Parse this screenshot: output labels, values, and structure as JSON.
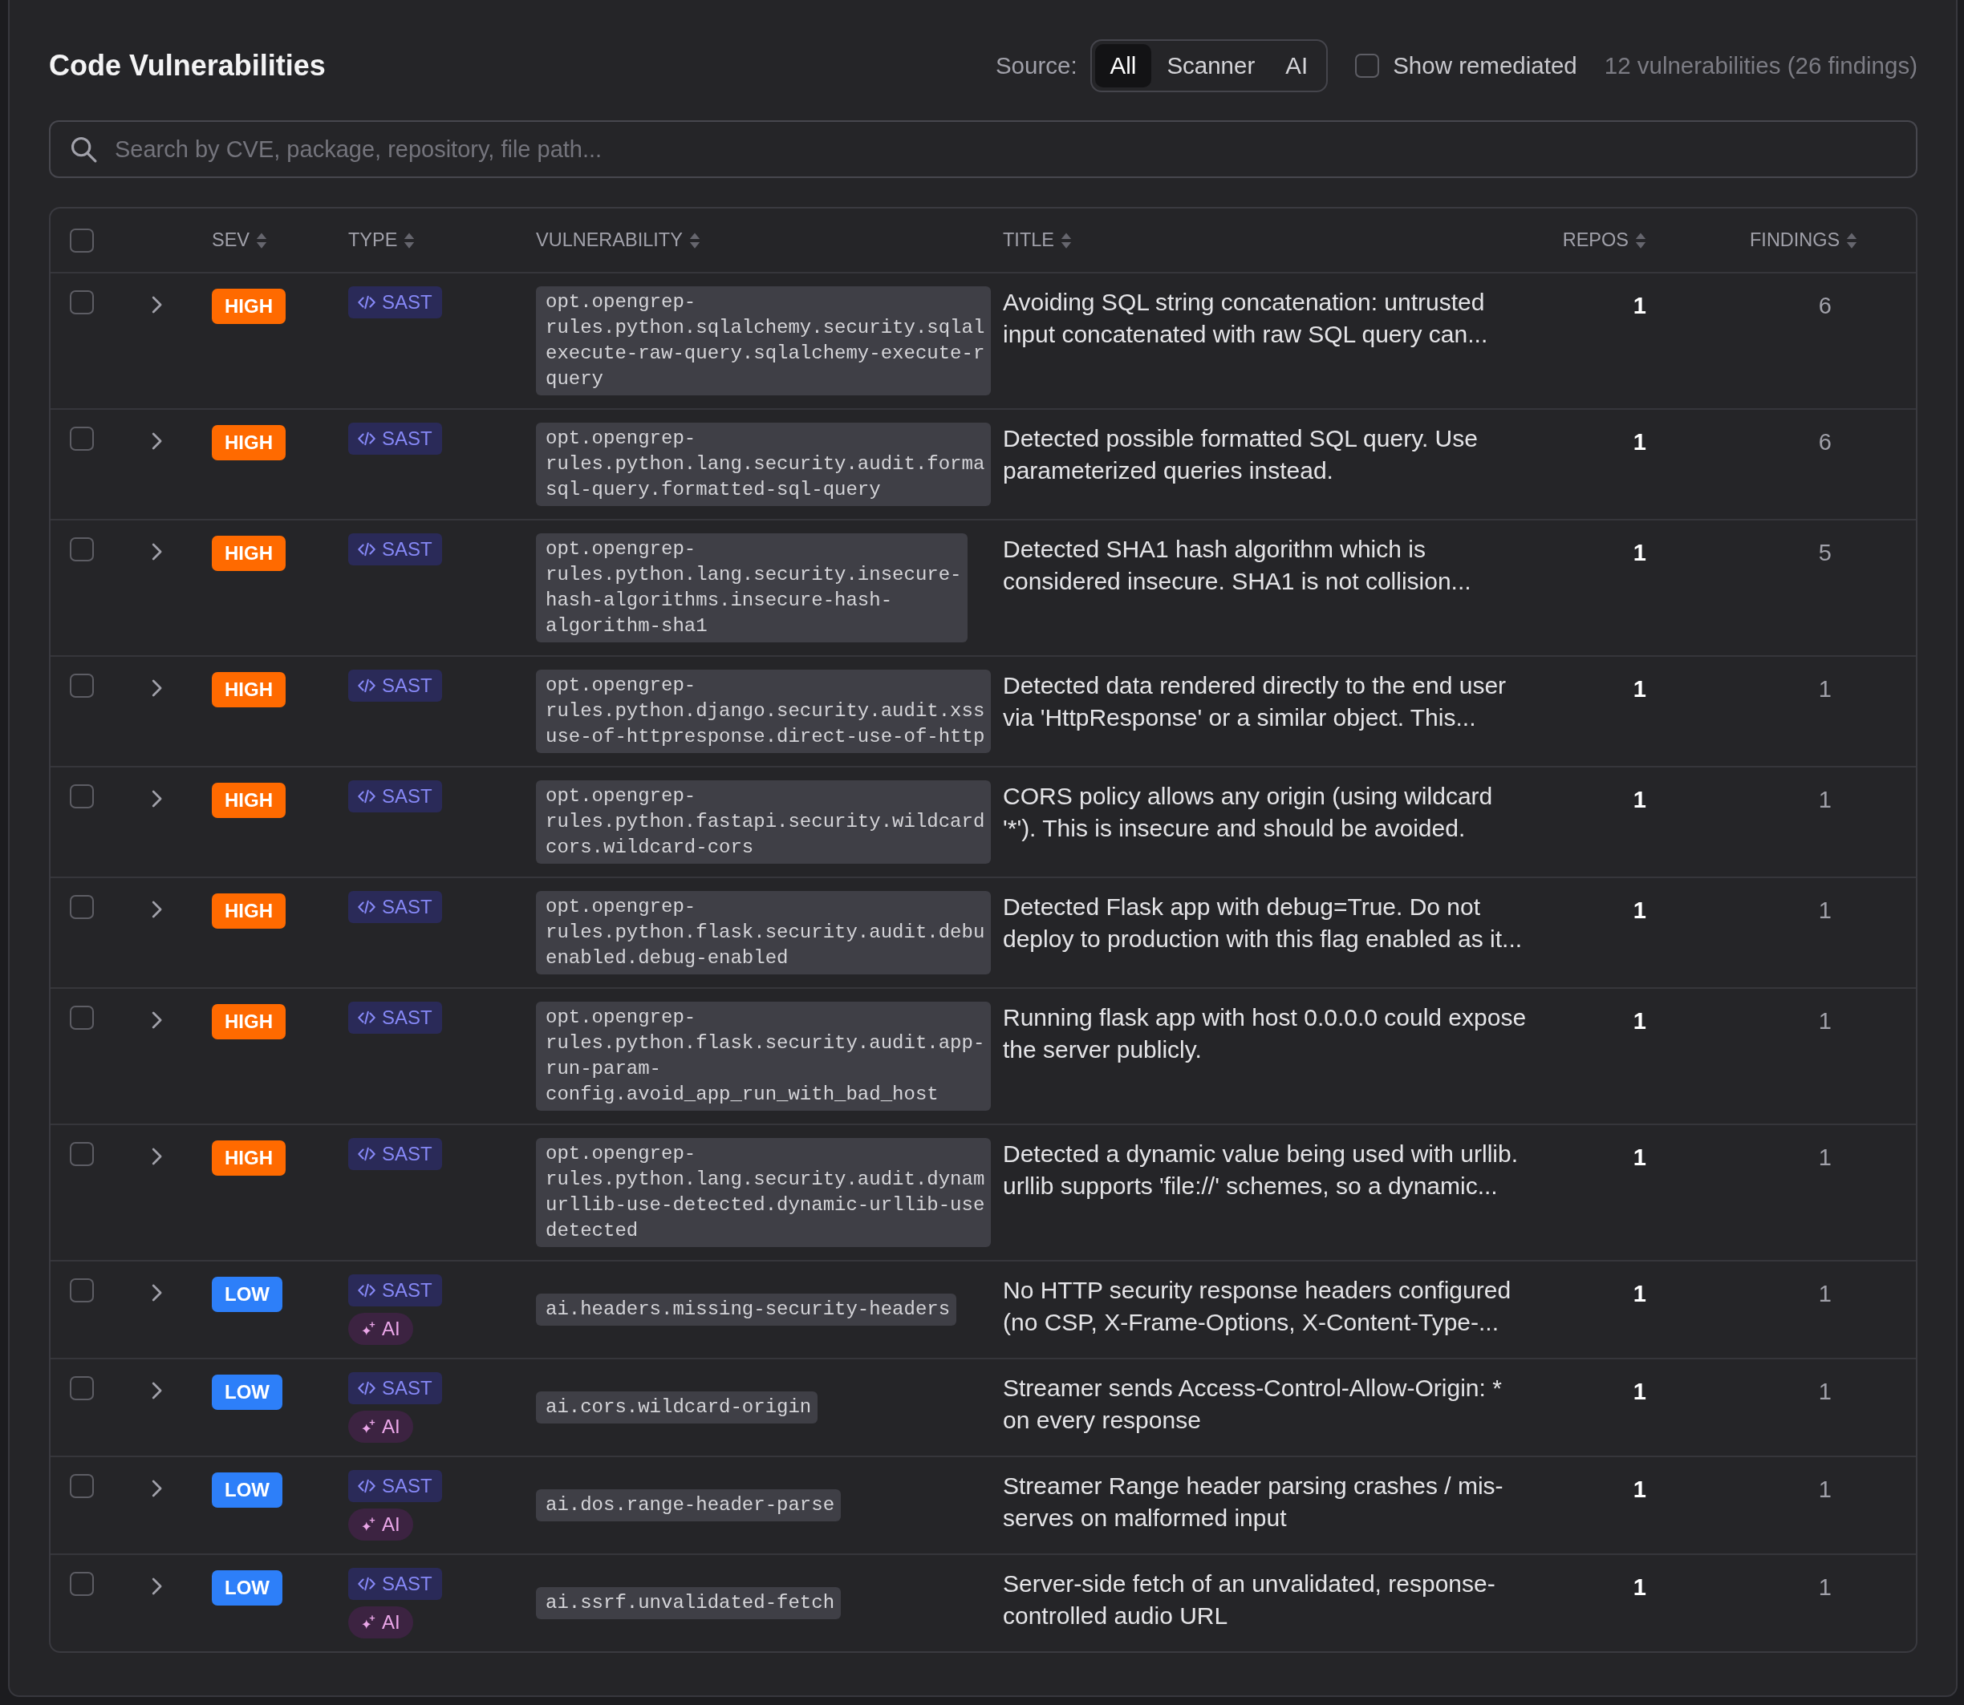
{
  "header": {
    "title": "Code Vulnerabilities",
    "source_filter": {
      "label": "Source:",
      "options": [
        {
          "label": "All",
          "selected": true
        },
        {
          "label": "Scanner",
          "selected": false
        },
        {
          "label": "AI",
          "selected": false
        }
      ]
    },
    "show_remediated": {
      "label": "Show remediated",
      "checked": false
    },
    "summary": "12 vulnerabilities (26 findings)"
  },
  "search": {
    "placeholder": "Search by CVE, package, repository, file path..."
  },
  "table": {
    "select_all": {
      "checked": false
    },
    "columns": [
      {
        "label": "SEV",
        "sortable": true
      },
      {
        "label": "TYPE",
        "sortable": true
      },
      {
        "label": "VULNERABILITY",
        "sortable": true
      },
      {
        "label": "TITLE",
        "sortable": true
      },
      {
        "label": "REPOS",
        "sortable": true
      },
      {
        "label": "FINDINGS",
        "sortable": true
      }
    ],
    "rows": [
      {
        "selected": false,
        "expanded": false,
        "severity": {
          "label": "HIGH",
          "color": "#ff6a00"
        },
        "types": [
          {
            "kind": "sast",
            "label": "SAST"
          }
        ],
        "vulnerability": "opt.opengrep-\nrules.python.sqlalchemy.security.sqlal\nexecute-raw-query.sqlalchemy-execute-r\nquery",
        "title": "Avoiding SQL string concatenation: untrusted input concatenated with raw SQL query can...",
        "repos": "1",
        "findings": "6"
      },
      {
        "selected": false,
        "expanded": false,
        "severity": {
          "label": "HIGH",
          "color": "#ff6a00"
        },
        "types": [
          {
            "kind": "sast",
            "label": "SAST"
          }
        ],
        "vulnerability": "opt.opengrep-\nrules.python.lang.security.audit.forma\nsql-query.formatted-sql-query",
        "title": "Detected possible formatted SQL query. Use parameterized queries instead.",
        "repos": "1",
        "findings": "6"
      },
      {
        "selected": false,
        "expanded": false,
        "severity": {
          "label": "HIGH",
          "color": "#ff6a00"
        },
        "types": [
          {
            "kind": "sast",
            "label": "SAST"
          }
        ],
        "vulnerability": "opt.opengrep-\nrules.python.lang.security.insecure-\nhash-algorithms.insecure-hash-\nalgorithm-sha1",
        "title": "Detected SHA1 hash algorithm which is considered insecure. SHA1 is not collision...",
        "repos": "1",
        "findings": "5"
      },
      {
        "selected": false,
        "expanded": false,
        "severity": {
          "label": "HIGH",
          "color": "#ff6a00"
        },
        "types": [
          {
            "kind": "sast",
            "label": "SAST"
          }
        ],
        "vulnerability": "opt.opengrep-\nrules.python.django.security.audit.xss\nuse-of-httpresponse.direct-use-of-http",
        "title": "Detected data rendered directly to the end user via 'HttpResponse' or a similar object. This...",
        "repos": "1",
        "findings": "1"
      },
      {
        "selected": false,
        "expanded": false,
        "severity": {
          "label": "HIGH",
          "color": "#ff6a00"
        },
        "types": [
          {
            "kind": "sast",
            "label": "SAST"
          }
        ],
        "vulnerability": "opt.opengrep-\nrules.python.fastapi.security.wildcard\ncors.wildcard-cors",
        "title": "CORS policy allows any origin (using wildcard '*'). This is insecure and should be avoided.",
        "repos": "1",
        "findings": "1"
      },
      {
        "selected": false,
        "expanded": false,
        "severity": {
          "label": "HIGH",
          "color": "#ff6a00"
        },
        "types": [
          {
            "kind": "sast",
            "label": "SAST"
          }
        ],
        "vulnerability": "opt.opengrep-\nrules.python.flask.security.audit.debu\nenabled.debug-enabled",
        "title": "Detected Flask app with debug=True. Do not deploy to production with this flag enabled as it...",
        "repos": "1",
        "findings": "1"
      },
      {
        "selected": false,
        "expanded": false,
        "severity": {
          "label": "HIGH",
          "color": "#ff6a00"
        },
        "types": [
          {
            "kind": "sast",
            "label": "SAST"
          }
        ],
        "vulnerability": "opt.opengrep-\nrules.python.flask.security.audit.app-\nrun-param-\nconfig.avoid_app_run_with_bad_host",
        "title": "Running flask app with host 0.0.0.0 could expose the server publicly.",
        "repos": "1",
        "findings": "1"
      },
      {
        "selected": false,
        "expanded": false,
        "severity": {
          "label": "HIGH",
          "color": "#ff6a00"
        },
        "types": [
          {
            "kind": "sast",
            "label": "SAST"
          }
        ],
        "vulnerability": "opt.opengrep-\nrules.python.lang.security.audit.dynam\nurllib-use-detected.dynamic-urllib-use\ndetected",
        "title": "Detected a dynamic value being used with urllib. urllib supports 'file://' schemes, so a dynamic...",
        "repos": "1",
        "findings": "1"
      },
      {
        "selected": false,
        "expanded": false,
        "severity": {
          "label": "LOW",
          "color": "#2d7ff9"
        },
        "types": [
          {
            "kind": "sast",
            "label": "SAST"
          },
          {
            "kind": "ai",
            "label": "AI"
          }
        ],
        "vulnerability": "ai.headers.missing-security-headers",
        "title": "No HTTP security response headers configured (no CSP, X-Frame-Options, X-Content-Type-...",
        "repos": "1",
        "findings": "1"
      },
      {
        "selected": false,
        "expanded": false,
        "severity": {
          "label": "LOW",
          "color": "#2d7ff9"
        },
        "types": [
          {
            "kind": "sast",
            "label": "SAST"
          },
          {
            "kind": "ai",
            "label": "AI"
          }
        ],
        "vulnerability": "ai.cors.wildcard-origin",
        "title": "Streamer sends Access-Control-Allow-Origin: * on every response",
        "repos": "1",
        "findings": "1"
      },
      {
        "selected": false,
        "expanded": false,
        "severity": {
          "label": "LOW",
          "color": "#2d7ff9"
        },
        "types": [
          {
            "kind": "sast",
            "label": "SAST"
          },
          {
            "kind": "ai",
            "label": "AI"
          }
        ],
        "vulnerability": "ai.dos.range-header-parse",
        "title": "Streamer Range header parsing crashes / mis-serves on malformed input",
        "repos": "1",
        "findings": "1"
      },
      {
        "selected": false,
        "expanded": false,
        "severity": {
          "label": "LOW",
          "color": "#2d7ff9"
        },
        "types": [
          {
            "kind": "sast",
            "label": "SAST"
          },
          {
            "kind": "ai",
            "label": "AI"
          }
        ],
        "vulnerability": "ai.ssrf.unvalidated-fetch",
        "title": "Server-side fetch of an unvalidated, response-controlled audio URL",
        "repos": "1",
        "findings": "1"
      }
    ]
  }
}
